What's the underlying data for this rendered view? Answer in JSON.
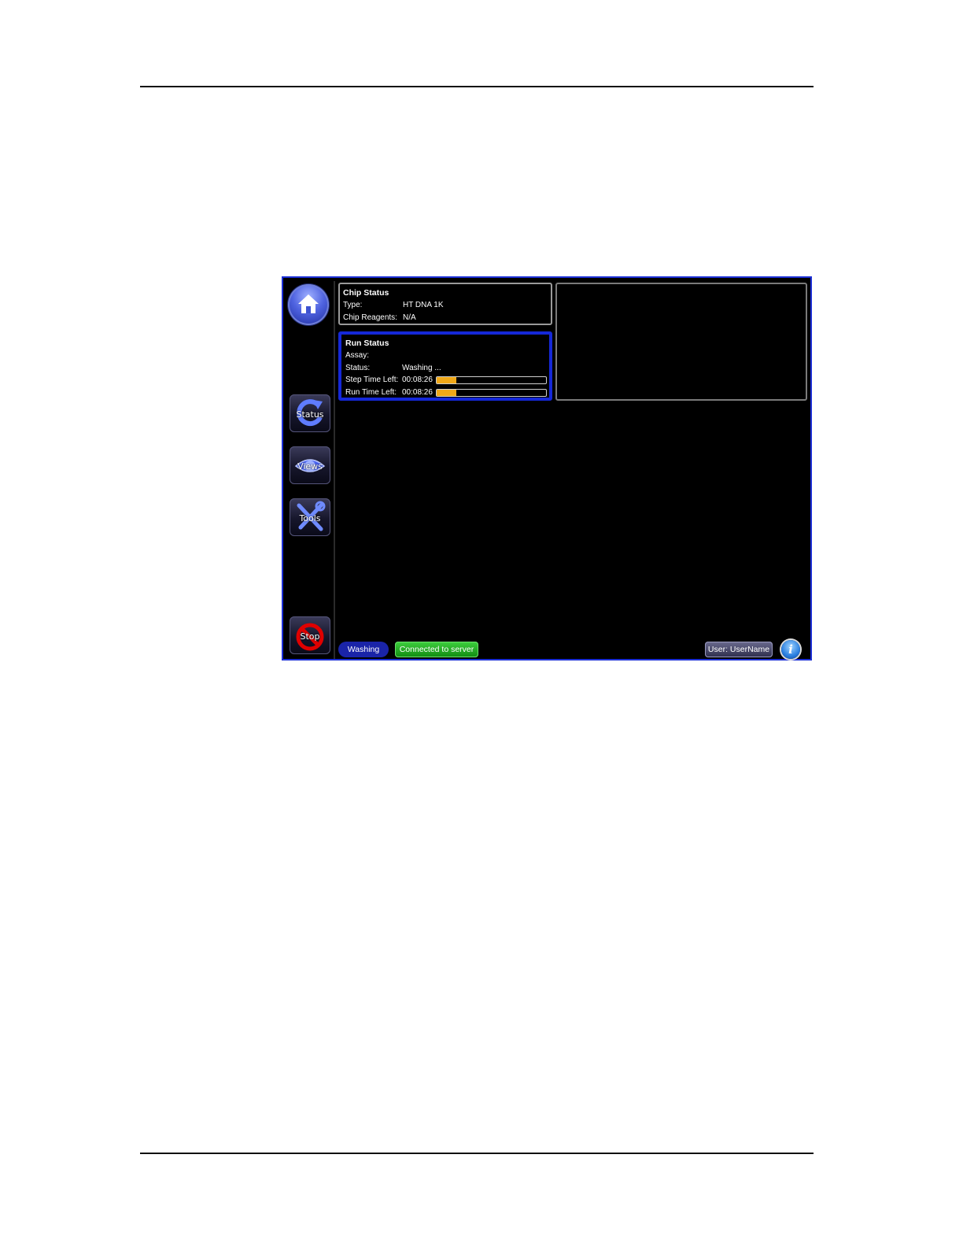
{
  "sidebar": {
    "status_label": "Status",
    "views_label": "Views",
    "tools_label": "Tools",
    "stop_label": "Stop"
  },
  "chip_status": {
    "title": "Chip Status",
    "rows": [
      {
        "key": "Type:",
        "value": "HT DNA 1K"
      },
      {
        "key": "Chip Reagents:",
        "value": "N/A"
      }
    ]
  },
  "run_status": {
    "title": "Run Status",
    "assay_label": "Assay:",
    "assay_value": "",
    "status_label": "Status:",
    "status_value": "Washing ...",
    "step_label": "Step Time Left:",
    "step_value": "00:08:26",
    "step_progress_percent": 18,
    "run_label": "Run Time Left:",
    "run_value": "00:08:26",
    "run_progress_percent": 18
  },
  "status_bar": {
    "state": "Washing",
    "connection": "Connected to server",
    "user": "User: UserName"
  },
  "colors": {
    "frame_border": "#1c2fd6",
    "run_panel_border": "#1528d8",
    "progress_fill": "#f0a818",
    "connected_green": "#22a822"
  }
}
